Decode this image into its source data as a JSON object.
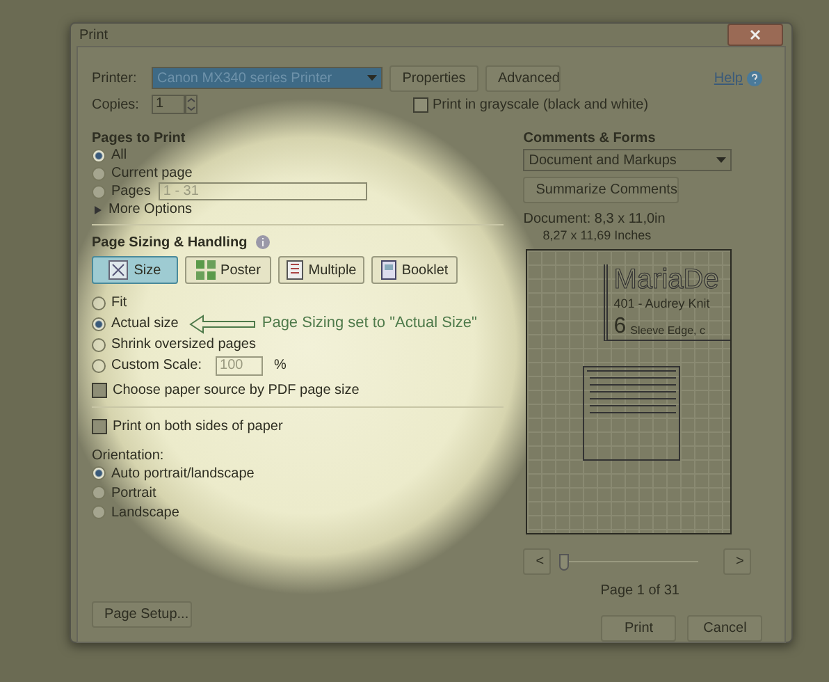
{
  "window": {
    "title": "Print"
  },
  "printer": {
    "label": "Printer:",
    "value": "Canon MX340 series Printer",
    "buttons": [
      "Properties",
      "Advanced"
    ],
    "help": "Help"
  },
  "copies": {
    "label": "Copies:",
    "value": "1"
  },
  "grayscale": {
    "label": "Print in grayscale (black and white)",
    "checked": false
  },
  "pages_to_print": {
    "heading": "Pages to Print",
    "options": [
      {
        "label": "All",
        "selected": true
      },
      {
        "label": "Current page",
        "selected": false
      },
      {
        "label": "Pages",
        "selected": false
      }
    ],
    "pages_value": "1 - 31",
    "more_options": "More Options"
  },
  "page_sizing": {
    "heading": "Page Sizing & Handling",
    "modes": [
      {
        "label": "Size",
        "selected": true
      },
      {
        "label": "Poster",
        "selected": false
      },
      {
        "label": "Multiple",
        "selected": false
      },
      {
        "label": "Booklet",
        "selected": false
      }
    ],
    "options": [
      {
        "label": "Fit",
        "selected": false
      },
      {
        "label": "Actual size",
        "selected": true
      },
      {
        "label": "Shrink oversized pages",
        "selected": false
      },
      {
        "label": "Custom Scale:",
        "selected": false
      }
    ],
    "scale_value": "100",
    "scale_unit": "%",
    "annotation": "Page Sizing set to \"Actual Size\""
  },
  "checkboxes": [
    {
      "label": "Choose paper source by PDF page size",
      "checked": false
    },
    {
      "label": "Print on both sides of paper",
      "checked": false
    }
  ],
  "orientation": {
    "heading": "Orientation:",
    "options": [
      {
        "label": "Auto portrait/landscape",
        "selected": true
      },
      {
        "label": "Portrait",
        "selected": false
      },
      {
        "label": "Landscape",
        "selected": false
      }
    ]
  },
  "comments": {
    "heading": "Comments & Forms",
    "value": "Document and Markups",
    "button": "Summarize Comments",
    "document": "Document: 8,3 x 11,0in",
    "paper": "8,27 x 11,69 Inches"
  },
  "preview": {
    "title": "MariaDe",
    "line_1": "401 - Audrey Knit",
    "number": "6",
    "line_2": "Sleeve Edge, c",
    "prev": "<",
    "next": ">",
    "level": 0,
    "page_label": "Page 1 of 31"
  },
  "footer": {
    "page_setup": "Page Setup...",
    "print": "Print",
    "cancel": "Cancel"
  }
}
